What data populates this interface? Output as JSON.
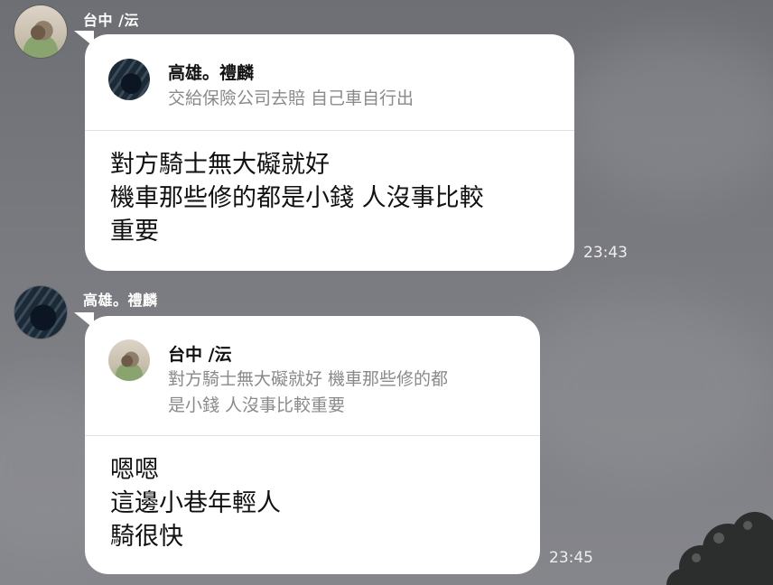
{
  "messages": [
    {
      "sender": "台中 /沄",
      "avatar_icon": "cat-avatar-icon",
      "reply": {
        "name": "高雄。禮麟",
        "avatar_icon": "car-avatar-icon",
        "lines": [
          "交給保險公司去賠 自己車自行出"
        ]
      },
      "body_lines": [
        "對方騎士無大礙就好",
        "機車那些修的都是小錢 人沒事比較",
        "重要"
      ],
      "time": "23:43"
    },
    {
      "sender": "高雄。禮麟",
      "avatar_icon": "car-avatar-icon",
      "reply": {
        "name": "台中 /沄",
        "avatar_icon": "cat-avatar-icon",
        "lines": [
          "對方騎士無大礙就好 機車那些修的都",
          "是小錢 人沒事比較重要"
        ]
      },
      "body_lines": [
        "嗯嗯",
        "這邊小巷年輕人",
        "騎很快"
      ],
      "time": "23:45"
    }
  ]
}
